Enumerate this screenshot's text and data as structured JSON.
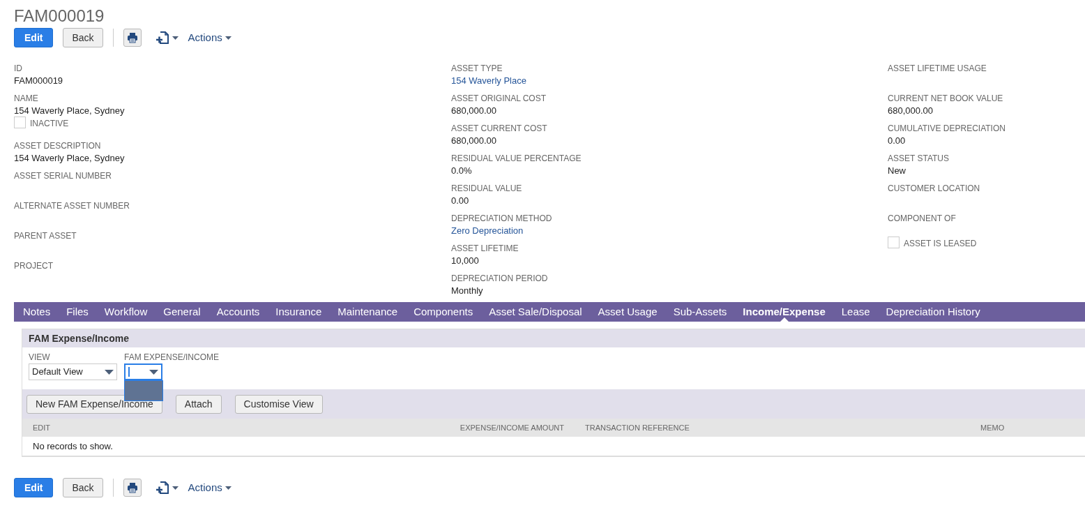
{
  "title": "FAM000019",
  "toolbar_top": {
    "edit": "Edit",
    "back": "Back",
    "actions": "Actions"
  },
  "columns": [
    [
      {
        "kind": "field",
        "label": "ID",
        "value": "FAM000019"
      },
      {
        "kind": "field",
        "label": "NAME",
        "value": "154 Waverly Place, Sydney"
      },
      {
        "kind": "checkbox",
        "label": "INACTIVE",
        "checked": false
      },
      {
        "kind": "field",
        "label": "ASSET DESCRIPTION",
        "value": "154 Waverly Place, Sydney"
      },
      {
        "kind": "field",
        "label": "ASSET SERIAL NUMBER"
      },
      {
        "kind": "field",
        "label": "ALTERNATE ASSET NUMBER"
      },
      {
        "kind": "field",
        "label": "PARENT ASSET"
      },
      {
        "kind": "field",
        "label": "PROJECT"
      }
    ],
    [
      {
        "kind": "field",
        "label": "ASSET TYPE",
        "value": "154 Waverly Place",
        "link": true
      },
      {
        "kind": "field",
        "label": "ASSET ORIGINAL COST",
        "value": "680,000.00"
      },
      {
        "kind": "field",
        "label": "ASSET CURRENT COST",
        "value": "680,000.00"
      },
      {
        "kind": "field",
        "label": "RESIDUAL VALUE PERCENTAGE",
        "value": "0.0%"
      },
      {
        "kind": "field",
        "label": "RESIDUAL VALUE",
        "value": "0.00"
      },
      {
        "kind": "field",
        "label": "DEPRECIATION METHOD",
        "value": "Zero Depreciation",
        "link": true
      },
      {
        "kind": "field",
        "label": "ASSET LIFETIME",
        "value": "10,000"
      },
      {
        "kind": "field",
        "label": "DEPRECIATION PERIOD",
        "value": "Monthly"
      }
    ],
    [
      {
        "kind": "field",
        "label": "ASSET LIFETIME USAGE"
      },
      {
        "kind": "field",
        "label": "CURRENT NET BOOK VALUE",
        "value": "680,000.00"
      },
      {
        "kind": "field",
        "label": "CUMULATIVE DEPRECIATION",
        "value": "0.00"
      },
      {
        "kind": "field",
        "label": "ASSET STATUS",
        "value": "New"
      },
      {
        "kind": "field",
        "label": "CUSTOMER LOCATION"
      },
      {
        "kind": "field",
        "label": "COMPONENT OF"
      },
      {
        "kind": "checkbox",
        "label": "ASSET IS LEASED",
        "checked": false
      }
    ]
  ],
  "tabs": [
    {
      "label": "Notes",
      "selected": false
    },
    {
      "label": "Files",
      "selected": false
    },
    {
      "label": "Workflow",
      "selected": false
    },
    {
      "label": "General",
      "selected": false
    },
    {
      "label": "Accounts",
      "selected": false
    },
    {
      "label": "Insurance",
      "selected": false
    },
    {
      "label": "Maintenance",
      "selected": false
    },
    {
      "label": "Components",
      "selected": false
    },
    {
      "label": "Asset Sale/Disposal",
      "selected": false
    },
    {
      "label": "Asset Usage",
      "selected": false
    },
    {
      "label": "Sub-Assets",
      "selected": false
    },
    {
      "label": "Income/Expense",
      "selected": true
    },
    {
      "label": "Lease",
      "selected": false
    },
    {
      "label": "Depreciation History",
      "selected": false
    }
  ],
  "sublist": {
    "title": "FAM Expense/Income",
    "view": {
      "label": "VIEW",
      "value": "Default View"
    },
    "filter": {
      "label": "FAM EXPENSE/INCOME",
      "expanded": true
    },
    "buttons": [
      "New FAM Expense/Income",
      "Attach",
      "Customise View"
    ],
    "columns": [
      "EDIT",
      "EXPENSE/INCOME AMOUNT",
      "TRANSACTION REFERENCE",
      "MEMO"
    ],
    "empty": "No records to show."
  },
  "toolbar_bottom": {
    "edit": "Edit",
    "back": "Back",
    "actions": "Actions"
  }
}
